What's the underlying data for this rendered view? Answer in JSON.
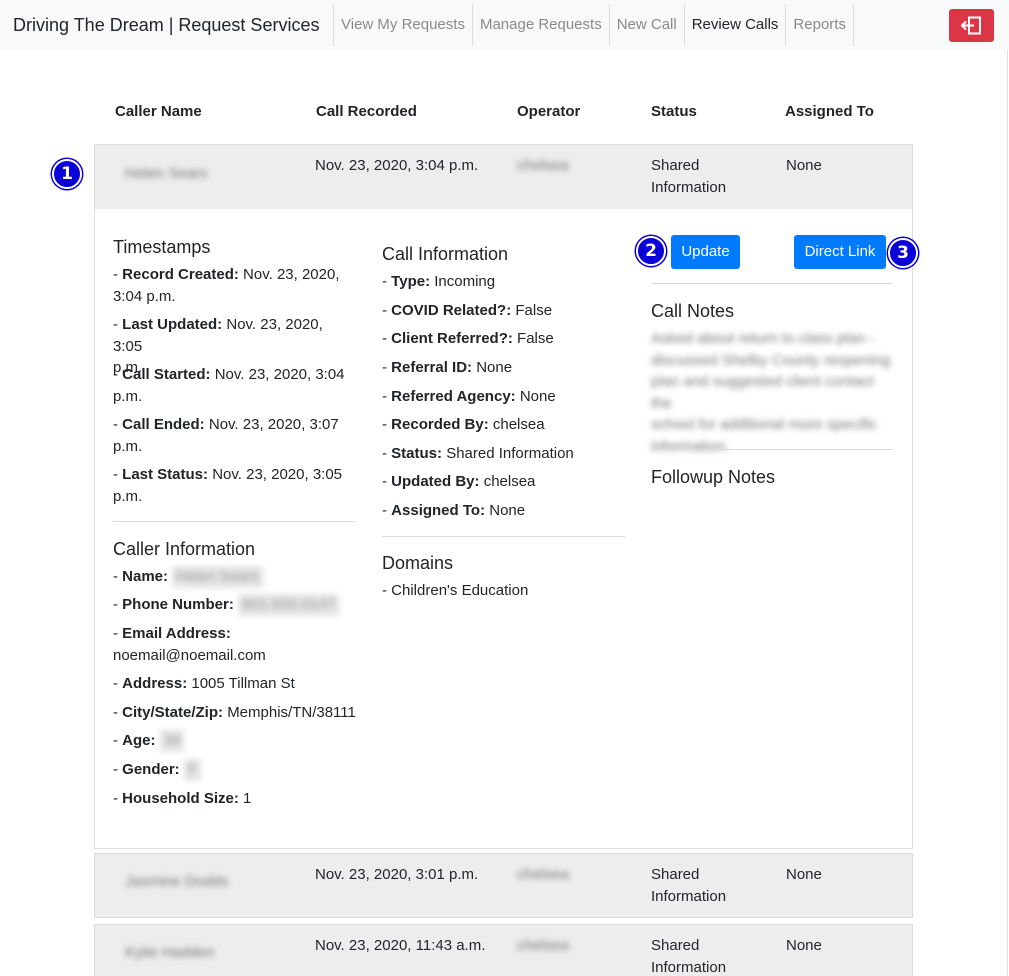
{
  "navbar": {
    "brand": "Driving The Dream | Request Services",
    "items": [
      "View My Requests",
      "Manage Requests",
      "New Call",
      "Review Calls",
      "Reports"
    ],
    "active": "Review Calls",
    "logout_icon": "sign-out-icon",
    "logout_color": "#dc3545"
  },
  "table": {
    "headers": [
      "Caller Name",
      "Call Recorded",
      "Operator",
      "Status",
      "Assigned To"
    ],
    "rows": [
      {
        "caller": "Helen Sears",
        "recorded": "Nov. 23, 2020, 3:04 p.m.",
        "operator": "chelsea",
        "status": "Shared Information",
        "assigned": "None"
      },
      {
        "caller": "Jasmine Dodds",
        "recorded": "Nov. 23, 2020, 3:01 p.m.",
        "operator": "chelsea",
        "status": "Shared Information",
        "assigned": "None"
      },
      {
        "caller": "Kylie Hadden",
        "recorded": "Nov. 23, 2020, 11:43 a.m.",
        "operator": "chelsea",
        "status": "Shared Information",
        "assigned": "None"
      }
    ]
  },
  "markers": [
    "1",
    "2",
    "3"
  ],
  "detail": {
    "timestamps": {
      "title": "Timestamps",
      "items": [
        {
          "label": "Record Created:",
          "value": "Nov. 23, 2020,",
          "value2": "3:04 p.m."
        },
        {
          "label": "Last Updated:",
          "value": "Nov. 23, 2020, 3:05",
          "value2": "p.m."
        },
        {
          "label": "Call Started:",
          "value": "Nov. 23, 2020, 3:04",
          "value2": "p.m."
        },
        {
          "label": "Call Ended:",
          "value": "Nov. 23, 2020, 3:07",
          "value2": "p.m."
        },
        {
          "label": "Last Status:",
          "value": "Nov. 23, 2020, 3:05",
          "value2": "p.m."
        }
      ]
    },
    "caller_info": {
      "title": "Caller Information",
      "name_label": "Name:",
      "name_value": "Helen Sears",
      "phone_label": "Phone Number:",
      "phone_value": "901-555-0147",
      "email_label": "Email Address:",
      "email_value": "noemail@noemail.com",
      "address_label": "Address:",
      "address_value": "1005 Tillman St",
      "city_label": "City/State/Zip:",
      "city_value": "Memphis/TN/38111",
      "age_label": "Age:",
      "age_value": "34",
      "gender_label": "Gender:",
      "gender_value": "F",
      "household_label": "Household Size:",
      "household_value": "1"
    },
    "call_info": {
      "title": "Call Information",
      "items": [
        {
          "label": "Type:",
          "value": "Incoming"
        },
        {
          "label": "COVID Related?:",
          "value": "False"
        },
        {
          "label": "Client Referred?:",
          "value": "False"
        },
        {
          "label": "Referral ID:",
          "value": "None"
        },
        {
          "label": "Referred Agency:",
          "value": "None"
        },
        {
          "label": "Recorded By:",
          "value": "chelsea"
        },
        {
          "label": "Status:",
          "value": "Shared Information"
        },
        {
          "label": "Updated By:",
          "value": "chelsea"
        },
        {
          "label": "Assigned To:",
          "value": "None"
        }
      ]
    },
    "domains": {
      "title": "Domains",
      "items": [
        "Children's Education"
      ]
    },
    "buttons": {
      "update": "Update",
      "direct_link": "Direct Link"
    },
    "call_notes": {
      "title": "Call Notes",
      "lines": [
        "Asked about return to class plan -",
        "discussed Shelby County reopening",
        "plan and suggested client contact the",
        "school for additional more specific",
        "information."
      ]
    },
    "followup_notes": {
      "title": "Followup Notes"
    }
  }
}
